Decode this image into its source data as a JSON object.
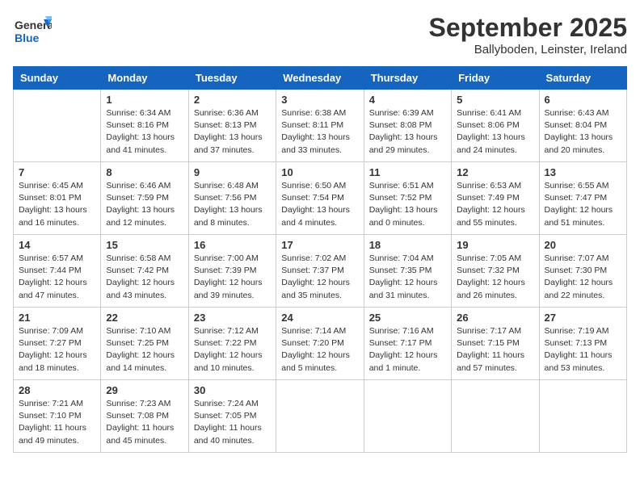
{
  "header": {
    "logo_line1": "General",
    "logo_line2": "Blue",
    "month": "September 2025",
    "location": "Ballyboden, Leinster, Ireland"
  },
  "days_of_week": [
    "Sunday",
    "Monday",
    "Tuesday",
    "Wednesday",
    "Thursday",
    "Friday",
    "Saturday"
  ],
  "weeks": [
    [
      {
        "day": "",
        "info": ""
      },
      {
        "day": "1",
        "info": "Sunrise: 6:34 AM\nSunset: 8:16 PM\nDaylight: 13 hours\nand 41 minutes."
      },
      {
        "day": "2",
        "info": "Sunrise: 6:36 AM\nSunset: 8:13 PM\nDaylight: 13 hours\nand 37 minutes."
      },
      {
        "day": "3",
        "info": "Sunrise: 6:38 AM\nSunset: 8:11 PM\nDaylight: 13 hours\nand 33 minutes."
      },
      {
        "day": "4",
        "info": "Sunrise: 6:39 AM\nSunset: 8:08 PM\nDaylight: 13 hours\nand 29 minutes."
      },
      {
        "day": "5",
        "info": "Sunrise: 6:41 AM\nSunset: 8:06 PM\nDaylight: 13 hours\nand 24 minutes."
      },
      {
        "day": "6",
        "info": "Sunrise: 6:43 AM\nSunset: 8:04 PM\nDaylight: 13 hours\nand 20 minutes."
      }
    ],
    [
      {
        "day": "7",
        "info": "Sunrise: 6:45 AM\nSunset: 8:01 PM\nDaylight: 13 hours\nand 16 minutes."
      },
      {
        "day": "8",
        "info": "Sunrise: 6:46 AM\nSunset: 7:59 PM\nDaylight: 13 hours\nand 12 minutes."
      },
      {
        "day": "9",
        "info": "Sunrise: 6:48 AM\nSunset: 7:56 PM\nDaylight: 13 hours\nand 8 minutes."
      },
      {
        "day": "10",
        "info": "Sunrise: 6:50 AM\nSunset: 7:54 PM\nDaylight: 13 hours\nand 4 minutes."
      },
      {
        "day": "11",
        "info": "Sunrise: 6:51 AM\nSunset: 7:52 PM\nDaylight: 13 hours\nand 0 minutes."
      },
      {
        "day": "12",
        "info": "Sunrise: 6:53 AM\nSunset: 7:49 PM\nDaylight: 12 hours\nand 55 minutes."
      },
      {
        "day": "13",
        "info": "Sunrise: 6:55 AM\nSunset: 7:47 PM\nDaylight: 12 hours\nand 51 minutes."
      }
    ],
    [
      {
        "day": "14",
        "info": "Sunrise: 6:57 AM\nSunset: 7:44 PM\nDaylight: 12 hours\nand 47 minutes."
      },
      {
        "day": "15",
        "info": "Sunrise: 6:58 AM\nSunset: 7:42 PM\nDaylight: 12 hours\nand 43 minutes."
      },
      {
        "day": "16",
        "info": "Sunrise: 7:00 AM\nSunset: 7:39 PM\nDaylight: 12 hours\nand 39 minutes."
      },
      {
        "day": "17",
        "info": "Sunrise: 7:02 AM\nSunset: 7:37 PM\nDaylight: 12 hours\nand 35 minutes."
      },
      {
        "day": "18",
        "info": "Sunrise: 7:04 AM\nSunset: 7:35 PM\nDaylight: 12 hours\nand 31 minutes."
      },
      {
        "day": "19",
        "info": "Sunrise: 7:05 AM\nSunset: 7:32 PM\nDaylight: 12 hours\nand 26 minutes."
      },
      {
        "day": "20",
        "info": "Sunrise: 7:07 AM\nSunset: 7:30 PM\nDaylight: 12 hours\nand 22 minutes."
      }
    ],
    [
      {
        "day": "21",
        "info": "Sunrise: 7:09 AM\nSunset: 7:27 PM\nDaylight: 12 hours\nand 18 minutes."
      },
      {
        "day": "22",
        "info": "Sunrise: 7:10 AM\nSunset: 7:25 PM\nDaylight: 12 hours\nand 14 minutes."
      },
      {
        "day": "23",
        "info": "Sunrise: 7:12 AM\nSunset: 7:22 PM\nDaylight: 12 hours\nand 10 minutes."
      },
      {
        "day": "24",
        "info": "Sunrise: 7:14 AM\nSunset: 7:20 PM\nDaylight: 12 hours\nand 5 minutes."
      },
      {
        "day": "25",
        "info": "Sunrise: 7:16 AM\nSunset: 7:17 PM\nDaylight: 12 hours\nand 1 minute."
      },
      {
        "day": "26",
        "info": "Sunrise: 7:17 AM\nSunset: 7:15 PM\nDaylight: 11 hours\nand 57 minutes."
      },
      {
        "day": "27",
        "info": "Sunrise: 7:19 AM\nSunset: 7:13 PM\nDaylight: 11 hours\nand 53 minutes."
      }
    ],
    [
      {
        "day": "28",
        "info": "Sunrise: 7:21 AM\nSunset: 7:10 PM\nDaylight: 11 hours\nand 49 minutes."
      },
      {
        "day": "29",
        "info": "Sunrise: 7:23 AM\nSunset: 7:08 PM\nDaylight: 11 hours\nand 45 minutes."
      },
      {
        "day": "30",
        "info": "Sunrise: 7:24 AM\nSunset: 7:05 PM\nDaylight: 11 hours\nand 40 minutes."
      },
      {
        "day": "",
        "info": ""
      },
      {
        "day": "",
        "info": ""
      },
      {
        "day": "",
        "info": ""
      },
      {
        "day": "",
        "info": ""
      }
    ]
  ]
}
